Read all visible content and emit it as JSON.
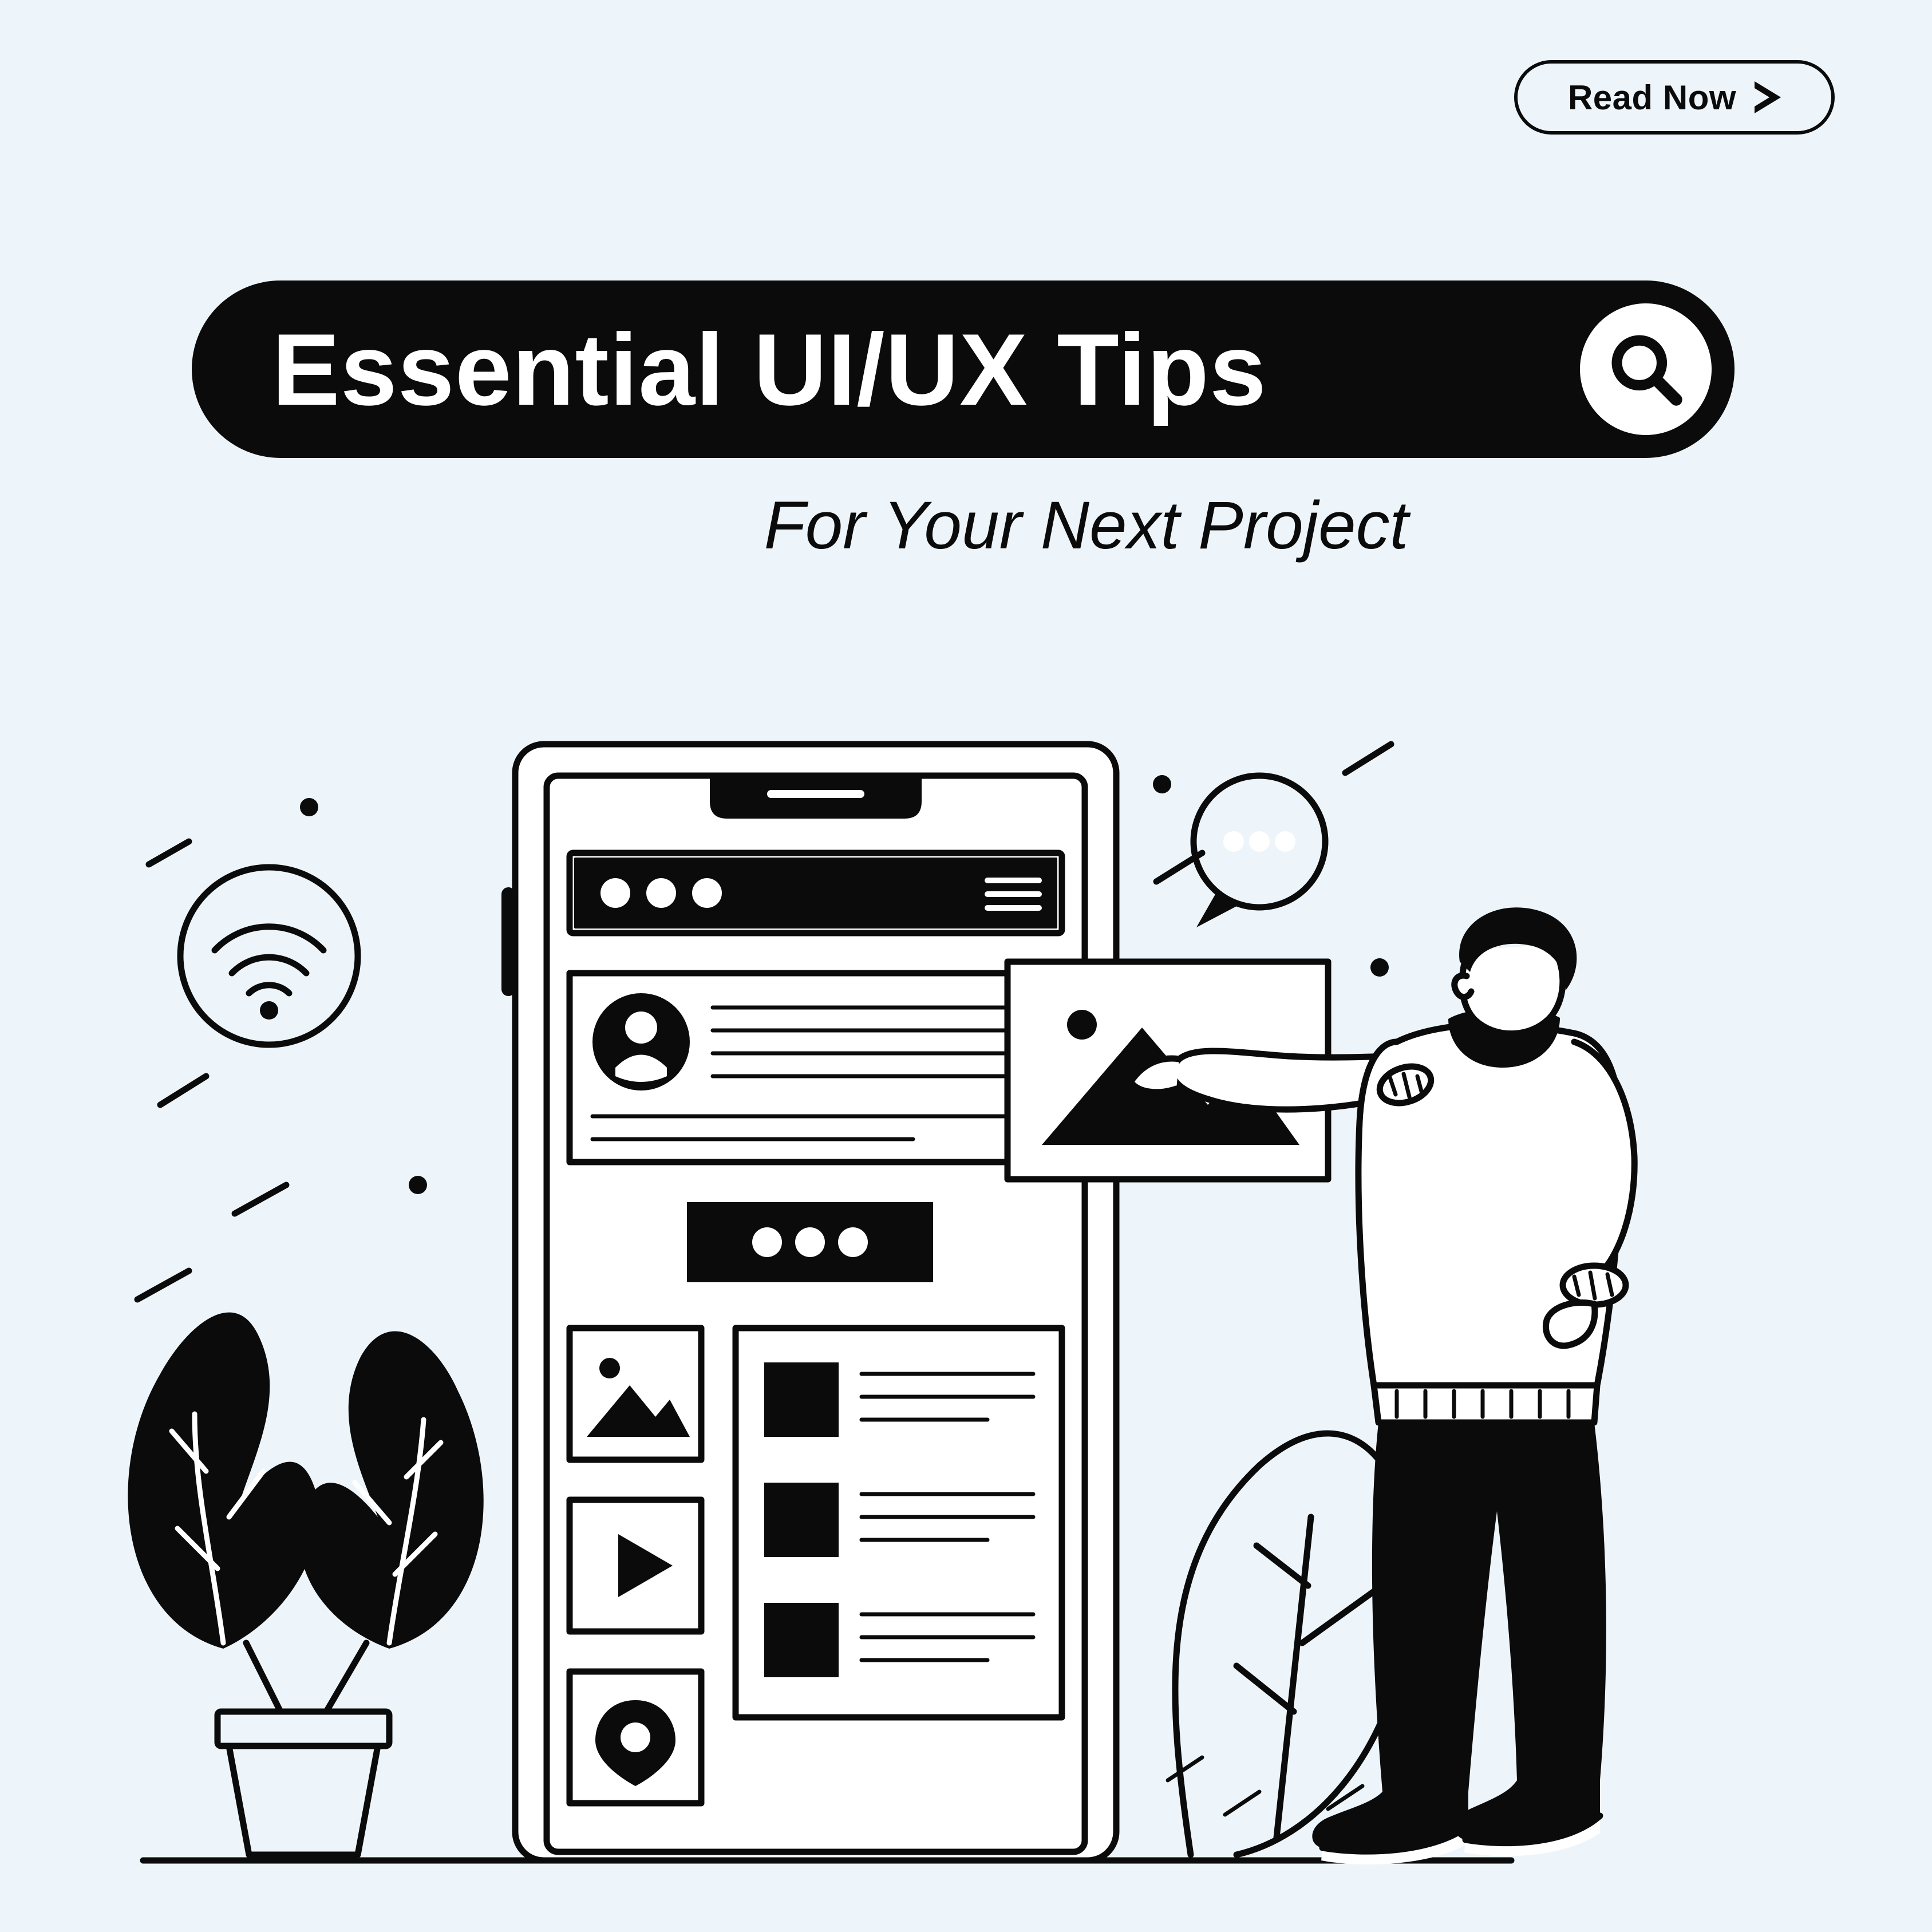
{
  "cta": {
    "label": "Read Now"
  },
  "title": "Essential UI/UX Tips",
  "subtitle": "For Your Next Project"
}
